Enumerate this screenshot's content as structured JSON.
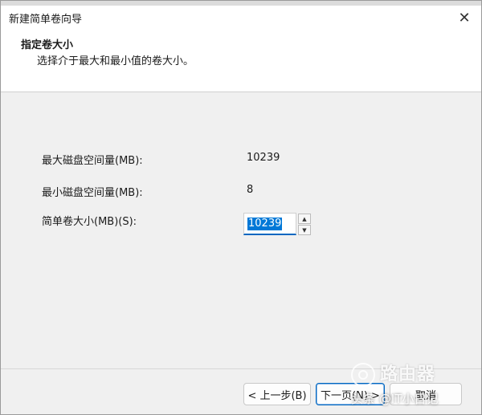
{
  "window": {
    "title": "新建简单卷向导",
    "close_glyph": "✕"
  },
  "header": {
    "title": "指定卷大小",
    "subtitle": "选择介于最大和最小值的卷大小。"
  },
  "fields": {
    "max_label": "最大磁盘空间量(MB):",
    "max_value": "10239",
    "min_label": "最小磁盘空间量(MB):",
    "min_value": "8",
    "size_label": "简单卷大小(MB)(S):",
    "size_value": "10239",
    "spin_up_glyph": "▲",
    "spin_down_glyph": "▼"
  },
  "buttons": {
    "back": "< 上一步(B)",
    "next": "下一页(N) >",
    "cancel": "取消"
  },
  "watermark": {
    "brand": "路由器",
    "source": "头条 @IT小日记"
  },
  "colors": {
    "accent": "#0067c0",
    "selection": "#0078d7"
  }
}
